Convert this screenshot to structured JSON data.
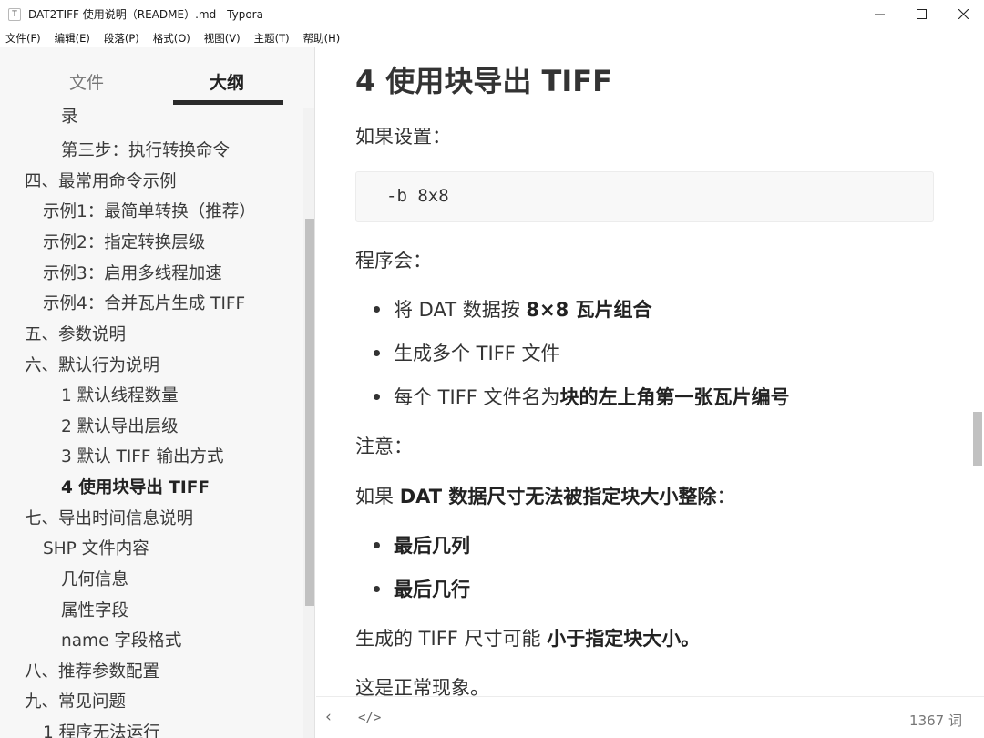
{
  "window": {
    "title": "DAT2TIFF 使用说明（README）.md - Typora",
    "app_icon": "T"
  },
  "menu": [
    "文件(F)",
    "编辑(E)",
    "段落(P)",
    "格式(O)",
    "视图(V)",
    "主题(T)",
    "帮助(H)"
  ],
  "sidebar": {
    "tabs": {
      "files": "文件",
      "outline": "大纲"
    },
    "outline": [
      {
        "label": "录"
      },
      {
        "label": "第三步：执行转换命令"
      },
      {
        "label": "四、最常用命令示例"
      },
      {
        "label": "示例1：最简单转换（推荐）"
      },
      {
        "label": "示例2：指定转换层级"
      },
      {
        "label": "示例3：启用多线程加速"
      },
      {
        "label": "示例4：合并瓦片生成 TIFF"
      },
      {
        "label": "五、参数说明"
      },
      {
        "label": "六、默认行为说明"
      },
      {
        "label": "1 默认线程数量"
      },
      {
        "label": "2 默认导出层级"
      },
      {
        "label": "3 默认 TIFF 输出方式"
      },
      {
        "label": "4 使用块导出 TIFF",
        "active": true
      },
      {
        "label": "七、导出时间信息说明"
      },
      {
        "label": "SHP 文件内容"
      },
      {
        "label": "几何信息"
      },
      {
        "label": "属性字段"
      },
      {
        "label": "name 字段格式"
      },
      {
        "label": "八、推荐参数配置"
      },
      {
        "label": "九、常见问题"
      },
      {
        "label": "1 程序无法运行"
      }
    ]
  },
  "editor": {
    "heading": "4 使用块导出 TIFF",
    "p_if_set": "如果设置：",
    "code": "-b 8x8",
    "p_program": "程序会：",
    "b1_pre": "将 DAT 数据按 ",
    "b1_bold": "8×8 瓦片组合",
    "b2": "生成多个 TIFF 文件",
    "b3_pre": "每个 TIFF 文件名为",
    "b3_bold": "块的左上角第一张瓦片编号",
    "p_note": "注意：",
    "p_if_pre": "如果 ",
    "p_if_bold": "DAT 数据尺寸无法被指定块大小整除",
    "p_if_post": "：",
    "b4_bold": "最后几列",
    "b5_bold": "最后几行",
    "p_size_pre": "生成的 TIFF 尺寸可能 ",
    "p_size_bold": "小于指定块大小。",
    "p_normal": "这是正常现象。"
  },
  "footer": {
    "back_icon": "‹",
    "source_icon": "</>",
    "word_count": "1367 词"
  }
}
